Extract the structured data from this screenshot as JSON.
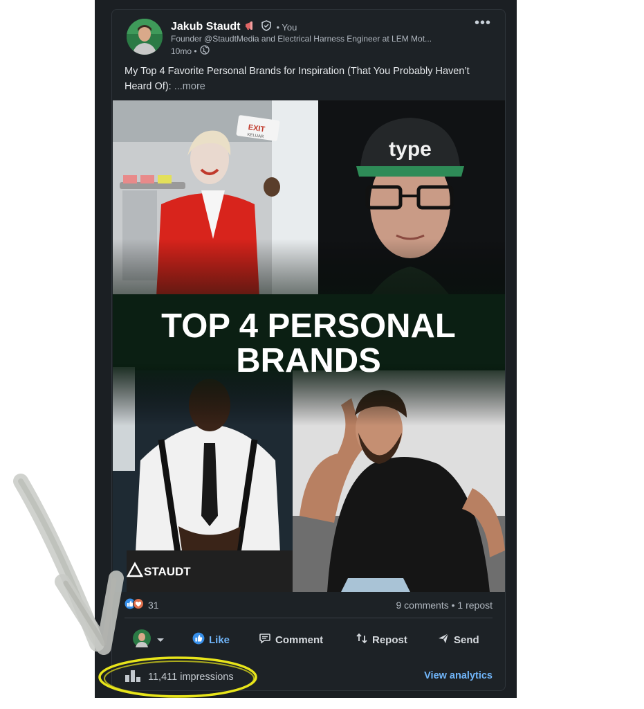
{
  "post": {
    "author_name": "Jakub Staudt",
    "you_label": "• You",
    "headline": "Founder @StaudtMedia and Electrical Harness Engineer at LEM Mot...",
    "time_ago": "10mo •",
    "text": "My Top 4 Favorite Personal Brands for Inspiration (That You Probably Haven’t Heard Of):",
    "more_label": "...more",
    "image": {
      "title_line1": "TOP 4 PERSONAL",
      "title_line2": "BRANDS",
      "cap_text": "type",
      "exit_sign": "EXIT",
      "exit_sub": "KELUAR",
      "watermark": "STAUDT"
    }
  },
  "social": {
    "reaction_count": "31",
    "comments_reposts": "9 comments • 1 repost"
  },
  "actions": {
    "like": "Like",
    "comment": "Comment",
    "repost": "Repost",
    "send": "Send"
  },
  "footer": {
    "impressions": "11,411 impressions",
    "view_analytics": "View analytics"
  },
  "icons": [
    "megaphone-icon",
    "verified-shield-icon",
    "globe-icon",
    "more-options-icon",
    "like-reaction-icon",
    "love-reaction-icon",
    "chevron-down-icon",
    "like-icon",
    "comment-icon",
    "repost-icon",
    "send-icon",
    "bar-chart-icon"
  ],
  "colors": {
    "link": "#70b5f9",
    "like_blue": "#378fe9",
    "love_red": "#df704d",
    "highlight_yellow": "#e8e51a"
  }
}
